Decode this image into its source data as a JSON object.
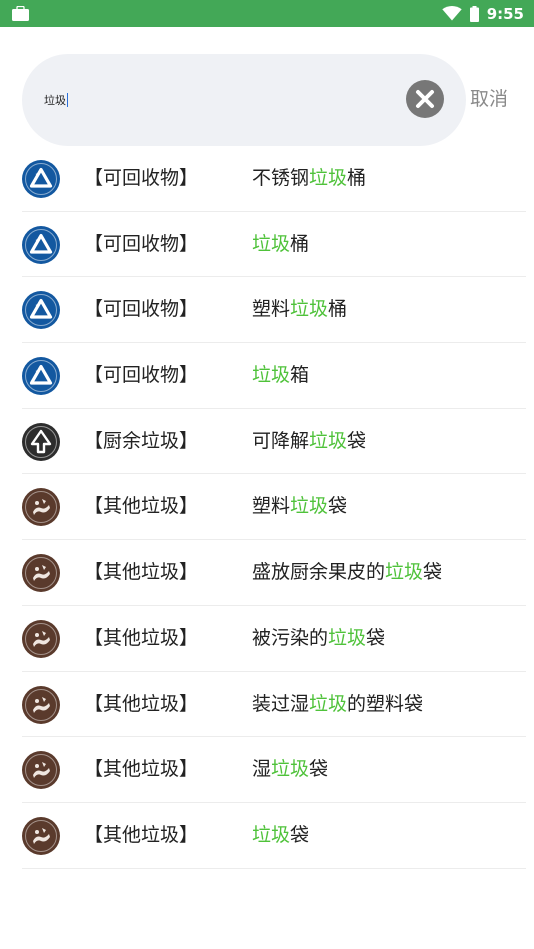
{
  "status_bar": {
    "time": "9:55",
    "bg_color": "#43a857"
  },
  "search": {
    "value": "垃圾",
    "clear_icon": "clear-circle-icon",
    "cancel_label": "取消"
  },
  "colors": {
    "highlight": "#4fc23a",
    "recyclable": "#1358a0",
    "kitchen": "#2d2d2d",
    "other": "#5a3a2c"
  },
  "results": [
    {
      "category": "【可回收物】",
      "type": "recyclable",
      "icon": "recycle-icon",
      "parts": [
        "不锈钢",
        "垃圾",
        "桶"
      ]
    },
    {
      "category": "【可回收物】",
      "type": "recyclable",
      "icon": "recycle-icon",
      "parts": [
        "",
        "垃圾",
        "桶"
      ]
    },
    {
      "category": "【可回收物】",
      "type": "recyclable",
      "icon": "recycle-icon",
      "parts": [
        "塑料",
        "垃圾",
        "桶"
      ]
    },
    {
      "category": "【可回收物】",
      "type": "recyclable",
      "icon": "recycle-icon",
      "parts": [
        "",
        "垃圾",
        "箱"
      ]
    },
    {
      "category": "【厨余垃圾】",
      "type": "kitchen",
      "icon": "kitchen-waste-icon",
      "parts": [
        "可降解",
        "垃圾",
        "袋"
      ]
    },
    {
      "category": "【其他垃圾】",
      "type": "other",
      "icon": "other-waste-icon",
      "parts": [
        "塑料",
        "垃圾",
        "袋"
      ]
    },
    {
      "category": "【其他垃圾】",
      "type": "other",
      "icon": "other-waste-icon",
      "parts": [
        "盛放厨余果皮的",
        "垃圾",
        "袋"
      ]
    },
    {
      "category": "【其他垃圾】",
      "type": "other",
      "icon": "other-waste-icon",
      "parts": [
        "被污染的",
        "垃圾",
        "袋"
      ]
    },
    {
      "category": "【其他垃圾】",
      "type": "other",
      "icon": "other-waste-icon",
      "parts": [
        "装过湿",
        "垃圾",
        "的塑料袋"
      ]
    },
    {
      "category": "【其他垃圾】",
      "type": "other",
      "icon": "other-waste-icon",
      "parts": [
        "湿",
        "垃圾",
        "袋"
      ]
    },
    {
      "category": "【其他垃圾】",
      "type": "other",
      "icon": "other-waste-icon",
      "parts": [
        "",
        "垃圾",
        "袋"
      ]
    }
  ]
}
